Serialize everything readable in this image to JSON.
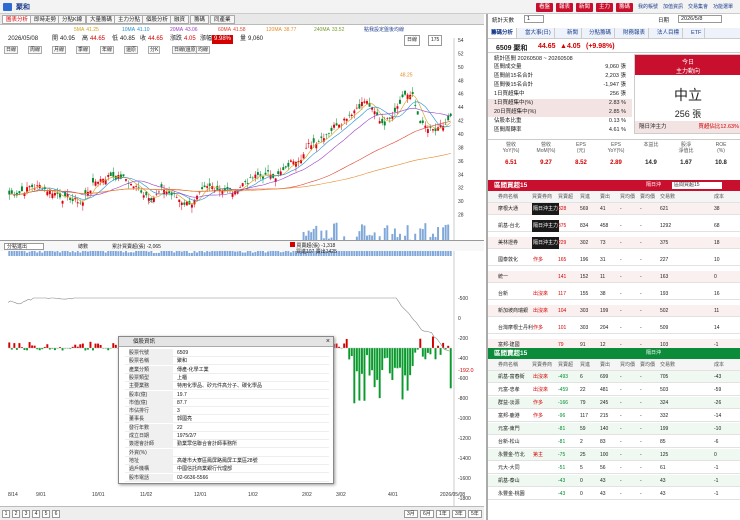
{
  "app": {
    "title": "聚和",
    "top_buttons": [
      "看盤",
      "報表",
      "新聞",
      "主力",
      "籌碼"
    ],
    "right_links": [
      "我的帳號",
      "加值資訊",
      "交易集會",
      "功能選單"
    ]
  },
  "left_tabs": [
    "圖表分析",
    "即時走勢",
    "分點K線",
    "大量籌碼",
    "主力分點",
    "個股分析",
    "融資",
    "籌碼",
    "同產業"
  ],
  "ma": [
    {
      "label": "5MA",
      "val": "41.25",
      "color": "#d4a017"
    },
    {
      "label": "10MA",
      "val": "41.10",
      "color": "#1f8fd4"
    },
    {
      "label": "20MA",
      "val": "43.06",
      "color": "#9b3ec9"
    },
    {
      "label": "60MA",
      "val": "41.58",
      "color": "#e0422e"
    },
    {
      "label": "120MA",
      "val": "38.77",
      "color": "#e88a28"
    },
    {
      "label": "240MA",
      "val": "33.52",
      "color": "#7a9a2d"
    }
  ],
  "ma_hint": "點我設定盤後均線",
  "price_info": {
    "date": "2026/05/08",
    "open_label": "開",
    "open": "40.95",
    "high_label": "高",
    "high": "44.65",
    "low_label": "低",
    "low": "40.85",
    "close_label": "收",
    "close": "44.65",
    "change_label": "漲跌",
    "change": "4.05",
    "pct_label": "漲幅",
    "pct": "9.98%",
    "vol_label": "量",
    "vol": "9,060",
    "period": "日線",
    "period_count": "175"
  },
  "daily_btn": "回",
  "toolbar_small": [
    "日線",
    "周線",
    "月線",
    "季線",
    "年線",
    "還原",
    "分K",
    "日線(還原)",
    "均線"
  ],
  "price_axis": [
    "54",
    "52",
    "50",
    "48",
    "46",
    "44",
    "42",
    "40",
    "38",
    "36",
    "34",
    "32",
    "30",
    "28"
  ],
  "price_high_marker": "48.25",
  "price_low_marker": "30",
  "lower": {
    "selector": "分點進出",
    "mode": "總數",
    "legend1": "累計買賣超(張)",
    "val1": "-2,065",
    "legend2": "買賣超(張)",
    "val2": "-1,318",
    "legend3": "買進107 賣出1425",
    "last_val": "-192.0"
  },
  "lower_axis": [
    "-500",
    "0",
    "-200",
    "-400",
    "-600",
    "-800",
    "-1000",
    "-1200",
    "-1400",
    "-1600",
    "-1800",
    "-2000"
  ],
  "date_axis": [
    "8/14\n2025",
    "9/01",
    "10/01",
    "11/02",
    "12/01",
    "1/02\n2026",
    "2/02",
    "3/02",
    "4/01",
    "2026/05/08"
  ],
  "popup": {
    "title": "個股資訊",
    "rows": [
      {
        "k": "股票代號",
        "v": "6509"
      },
      {
        "k": "股票名稱",
        "v": "聚和"
      },
      {
        "k": "產業分類",
        "v": "傳產-化學工業"
      },
      {
        "k": "股票類型",
        "v": "上櫃"
      },
      {
        "k": "主要業務",
        "v": "特用化學品、矽元件高分子、碳化學品"
      },
      {
        "k": "股本(億)",
        "v": "19.7"
      },
      {
        "k": "市值(億)",
        "v": "87.7"
      },
      {
        "k": "市佔排行",
        "v": "3"
      },
      {
        "k": "董事長",
        "v": "郭國亮"
      },
      {
        "k": "發行年數",
        "v": "22"
      },
      {
        "k": "成立日期",
        "v": "1975/2/7"
      },
      {
        "k": "簽證會計師",
        "v": "勤業眾信聯合會計師事務所"
      },
      {
        "k": "外資(%)",
        "v": ""
      },
      {
        "k": "地址",
        "v": "高雄市大寮區鳳屏路鳳屏工業區28號"
      },
      {
        "k": "過戶機構",
        "v": "中國信託商業銀行代理部"
      },
      {
        "k": "股市電話",
        "v": "02-6636-5566"
      }
    ]
  },
  "pager": [
    "1",
    "2",
    "3",
    "4",
    "5",
    "6"
  ],
  "timeframes": [
    "3月",
    "6月",
    "1年",
    "3年",
    "5年"
  ],
  "right": {
    "top_select": "統計天數",
    "top_select_val": "1",
    "date": "2026/5/8",
    "date_btn": "日期",
    "tabs": [
      "籌碼分析",
      "當大事(日)",
      "新聞",
      "分點籌碼",
      "財務報表",
      "法人目標",
      "ETF"
    ],
    "stock": "6509 聚和",
    "price": "44.65",
    "change": "4.05",
    "pct": "(+9.98%)",
    "stats_title": "統計區間  20260508 ~ 20260508",
    "stats": [
      {
        "k": "區間成交量",
        "v": "9,060 張"
      },
      {
        "k": "區間前15名合計",
        "v": "2,203 張"
      },
      {
        "k": "區間後15名合計",
        "v": "-1,947 張"
      },
      {
        "k": "1日買超集中",
        "v": "256 張"
      },
      {
        "k": "1日買超集中(%)",
        "v": "2.83 %"
      },
      {
        "k": "20日買超集中(%)",
        "v": "2.85 %"
      },
      {
        "k": "佔股本比重",
        "v": "0.13 %"
      },
      {
        "k": "區間周轉率",
        "v": "4.61 %"
      }
    ],
    "today_label": "今日",
    "today_sub": "主力動向",
    "verdict": "中立",
    "verdict_val": "256 張",
    "foot_left": "隔日沖主力",
    "foot_right": "買超佔比12.63%",
    "fund_heads": [
      "營收\nYoY(%)",
      "營收\nMoM(%)",
      "EPS\n(元)",
      "EPS\nYoY(%)",
      "本益比",
      "股淨\n淨值比",
      "ROE\n(%)"
    ],
    "fund_vals": [
      "6.51",
      "9.27",
      "8.52",
      "2.89",
      "14.9",
      "1.67",
      "10.8"
    ],
    "buy_title": "區間買超15",
    "sell_title": "區間賣超15",
    "sort_label": "隔日沖",
    "sort_val": "區間買超15",
    "col_heads": [
      "券商名稱",
      "買賣券商",
      "買賣超",
      "買進",
      "賣出",
      "買均價",
      "賣均價",
      "交易數",
      "成本"
    ],
    "buy_rows": [
      [
        "摩根大通",
        "隔日沖主力",
        "328",
        "569",
        "41",
        "-",
        "-",
        "621",
        "38"
      ],
      [
        "凱基-台北",
        "隔日沖主力",
        "375",
        "834",
        "458",
        "-",
        "-",
        "1292",
        "68"
      ],
      [
        "美林證券",
        "隔日沖主力",
        "229",
        "302",
        "73",
        "-",
        "-",
        "375",
        "18"
      ],
      [
        "國泰敦化",
        "作多",
        "165",
        "196",
        "31",
        "-",
        "-",
        "227",
        "10"
      ],
      [
        "統一",
        "",
        "141",
        "152",
        "11",
        "-",
        "-",
        "163",
        "0"
      ],
      [
        "台新",
        "出沒來",
        "117",
        "155",
        "38",
        "-",
        "-",
        "193",
        "16"
      ],
      [
        "新加坡商瑞銀",
        "出沒來",
        "104",
        "303",
        "199",
        "-",
        "-",
        "502",
        "11"
      ],
      [
        "台灣摩根士丹利",
        "作多",
        "101",
        "303",
        "204",
        "-",
        "-",
        "509",
        "14"
      ],
      [
        "富邦-建國",
        "",
        "79",
        "91",
        "12",
        "-",
        "-",
        "103",
        "-1"
      ]
    ],
    "sell_rows": [
      [
        "凱基-富春街",
        "出沒來",
        "-493",
        "6",
        "699",
        "-",
        "-",
        "705",
        "-43"
      ],
      [
        "元富-忠孝",
        "出沒來",
        "-459",
        "22",
        "481",
        "-",
        "-",
        "503",
        "-59"
      ],
      [
        "群益-淡源",
        "作多",
        "-166",
        "79",
        "245",
        "-",
        "-",
        "324",
        "-26"
      ],
      [
        "富邦-鹿港",
        "作多",
        "-96",
        "117",
        "215",
        "-",
        "-",
        "332",
        "-14"
      ],
      [
        "元富-東門",
        "",
        "-81",
        "59",
        "140",
        "-",
        "-",
        "199",
        "-10"
      ],
      [
        "台新-松山",
        "",
        "-81",
        "2",
        "83",
        "-",
        "-",
        "85",
        "-6"
      ],
      [
        "永豐金-竹北",
        "第主",
        "-75",
        "25",
        "100",
        "-",
        "-",
        "125",
        "0"
      ],
      [
        "元大-大同",
        "",
        "-51",
        "5",
        "56",
        "-",
        "-",
        "61",
        "-1"
      ],
      [
        "凱基-泰山",
        "",
        "-43",
        "0",
        "43",
        "-",
        "-",
        "43",
        "-1"
      ],
      [
        "永豐金-桃園",
        "",
        "-43",
        "0",
        "43",
        "-",
        "-",
        "43",
        "-1"
      ]
    ]
  }
}
